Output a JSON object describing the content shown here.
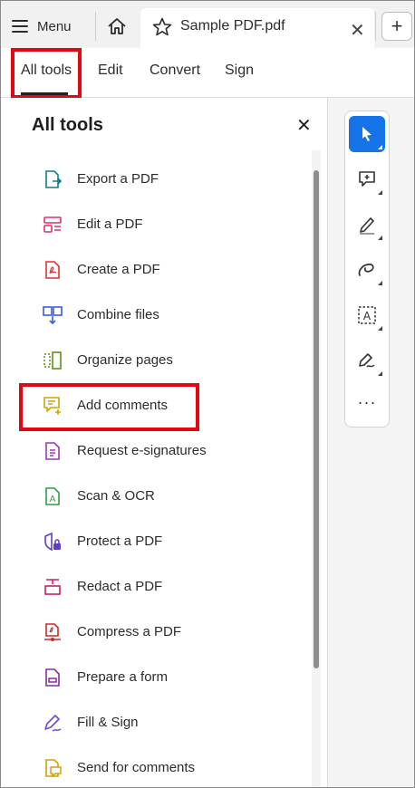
{
  "topbar": {
    "menu_label": "Menu",
    "doc_title": "Sample PDF.pdf",
    "close_glyph": "✕",
    "new_tab_glyph": "+"
  },
  "tabs": [
    {
      "label": "All tools",
      "active": true
    },
    {
      "label": "Edit",
      "active": false
    },
    {
      "label": "Convert",
      "active": false
    },
    {
      "label": "Sign",
      "active": false
    }
  ],
  "panel": {
    "title": "All tools",
    "close_glyph": "✕",
    "tools": [
      {
        "label": "Export a PDF",
        "icon": "export-pdf-icon",
        "color": "#0f7d8c"
      },
      {
        "label": "Edit a PDF",
        "icon": "edit-pdf-icon",
        "color": "#d6336c"
      },
      {
        "label": "Create a PDF",
        "icon": "create-pdf-icon",
        "color": "#e03131"
      },
      {
        "label": "Combine files",
        "icon": "combine-files-icon",
        "color": "#3b5bdb"
      },
      {
        "label": "Organize pages",
        "icon": "organize-pages-icon",
        "color": "#5c940d"
      },
      {
        "label": "Add comments",
        "icon": "add-comments-icon",
        "color": "#d4a000"
      },
      {
        "label": "Request e-signatures",
        "icon": "request-esign-icon",
        "color": "#9c36b5"
      },
      {
        "label": "Scan & OCR",
        "icon": "scan-ocr-icon",
        "color": "#2f9e44"
      },
      {
        "label": "Protect a PDF",
        "icon": "protect-pdf-icon",
        "color": "#5f3dc4"
      },
      {
        "label": "Redact a PDF",
        "icon": "redact-pdf-icon",
        "color": "#c2255c"
      },
      {
        "label": "Compress a PDF",
        "icon": "compress-pdf-icon",
        "color": "#c92a2a"
      },
      {
        "label": "Prepare a form",
        "icon": "prepare-form-icon",
        "color": "#862e9c"
      },
      {
        "label": "Fill & Sign",
        "icon": "fill-sign-icon",
        "color": "#7048e8"
      },
      {
        "label": "Send for comments",
        "icon": "send-comments-icon",
        "color": "#d4a000"
      }
    ]
  },
  "quick_tools": [
    {
      "icon": "select-cursor-icon",
      "active": true
    },
    {
      "icon": "add-comment-icon",
      "active": false
    },
    {
      "icon": "highlight-pen-icon",
      "active": false
    },
    {
      "icon": "freehand-draw-icon",
      "active": false
    },
    {
      "icon": "text-select-icon",
      "active": false
    },
    {
      "icon": "fill-sign-pen-icon",
      "active": false
    }
  ],
  "more_label": "···",
  "colors": {
    "accent": "#1473e6",
    "highlight_box": "#e30613"
  }
}
